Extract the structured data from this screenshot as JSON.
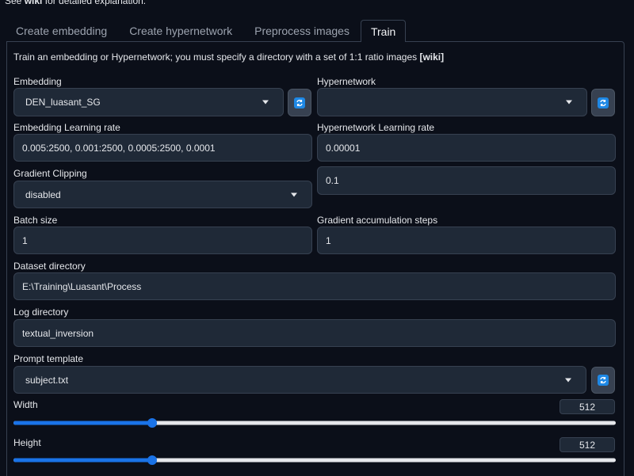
{
  "top_note": {
    "prefix": "See ",
    "link": "wiki",
    "suffix": " for detailed explanation."
  },
  "tabs": [
    {
      "label": "Create embedding"
    },
    {
      "label": "Create hypernetwork"
    },
    {
      "label": "Preprocess images"
    },
    {
      "label": "Train"
    }
  ],
  "description": {
    "text": "Train an embedding or Hypernetwork; you must specify a directory with a set of 1:1 ratio images ",
    "link": "[wiki]"
  },
  "embedding": {
    "label": "Embedding",
    "value": "DEN_luasant_SG"
  },
  "hypernetwork": {
    "label": "Hypernetwork",
    "value": ""
  },
  "embedding_lr": {
    "label": "Embedding Learning rate",
    "value": "0.005:2500, 0.001:2500, 0.0005:2500, 0.0001"
  },
  "hypernetwork_lr": {
    "label": "Hypernetwork Learning rate",
    "value": "0.00001"
  },
  "gradient_clipping": {
    "label": "Gradient Clipping",
    "value": "disabled",
    "extra_value": "0.1"
  },
  "batch_size": {
    "label": "Batch size",
    "value": "1"
  },
  "grad_accum": {
    "label": "Gradient accumulation steps",
    "value": "1"
  },
  "dataset_dir": {
    "label": "Dataset directory",
    "value": "E:\\Training\\Luasant\\Process"
  },
  "log_dir": {
    "label": "Log directory",
    "value": "textual_inversion"
  },
  "prompt_template": {
    "label": "Prompt template",
    "value": "subject.txt"
  },
  "width": {
    "label": "Width",
    "value": "512",
    "fraction": 0.23
  },
  "height": {
    "label": "Height",
    "value": "512",
    "fraction": 0.23
  },
  "colors": {
    "accent": "#1a73e8",
    "refresh_icon": "#1e88e5",
    "background": "#0b0f19",
    "input_bg": "#1f2937"
  },
  "icons": {
    "refresh": "refresh-icon",
    "dropdown": "chevron-down-icon"
  }
}
